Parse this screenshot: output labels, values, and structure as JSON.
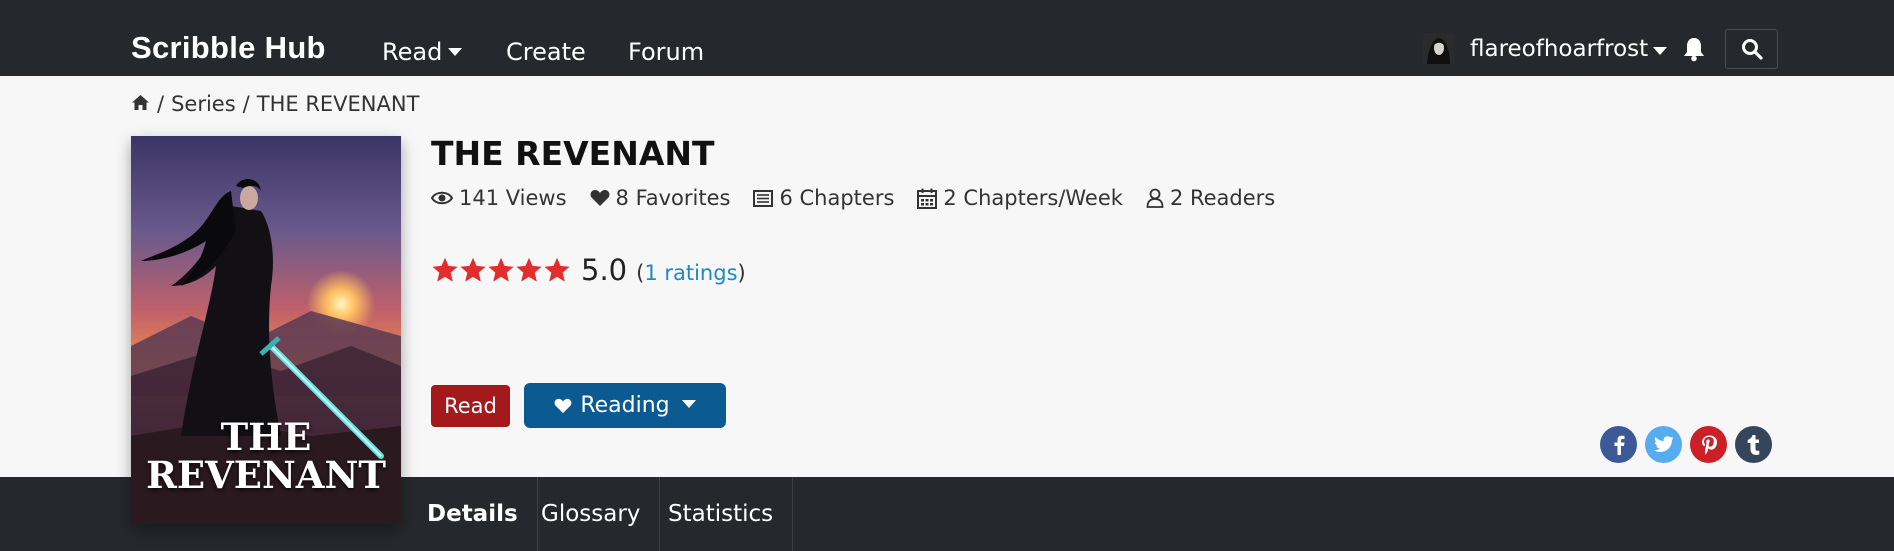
{
  "navbar": {
    "brand": "Scribble Hub",
    "links": [
      {
        "label": "Read",
        "has_dropdown": true
      },
      {
        "label": "Create"
      },
      {
        "label": "Forum"
      }
    ],
    "username": "flareofhoarfrost",
    "icons": [
      "caret-down-icon",
      "bell-icon",
      "search-icon"
    ]
  },
  "breadcrumb": {
    "home_icon": "home-icon",
    "separator": "/",
    "items": [
      "Series",
      "THE REVENANT"
    ]
  },
  "cover": {
    "title_line1": "THE",
    "title_line2": "REVENANT"
  },
  "series": {
    "title": "THE REVENANT",
    "stats": [
      {
        "icon": "eye-icon",
        "text": "141 Views"
      },
      {
        "icon": "heart-icon",
        "text": "8 Favorites"
      },
      {
        "icon": "list-icon",
        "text": "6 Chapters"
      },
      {
        "icon": "calendar-icon",
        "text": "2 Chapters/Week"
      },
      {
        "icon": "user-icon",
        "text": "2 Readers"
      }
    ],
    "rating": {
      "stars": 5,
      "value": "5.0",
      "open_paren": "(",
      "count_label": "1 ratings",
      "close_paren": ")",
      "star_color": "#e32d2d"
    }
  },
  "actions": {
    "read_label": "Read",
    "reading_label": "Reading",
    "read_color": "#a4191c",
    "reading_color": "#0b5a91"
  },
  "share": [
    {
      "name": "facebook",
      "glyph": "f",
      "color": "#3b5998"
    },
    {
      "name": "twitter",
      "glyph": "t",
      "color": "#55acee"
    },
    {
      "name": "pinterest",
      "glyph": "p",
      "color": "#cb2027"
    },
    {
      "name": "tumblr",
      "glyph": "t",
      "color": "#35465c"
    }
  ],
  "tabs": [
    {
      "label": "Details",
      "active": true
    },
    {
      "label": "Glossary"
    },
    {
      "label": "Statistics"
    }
  ]
}
